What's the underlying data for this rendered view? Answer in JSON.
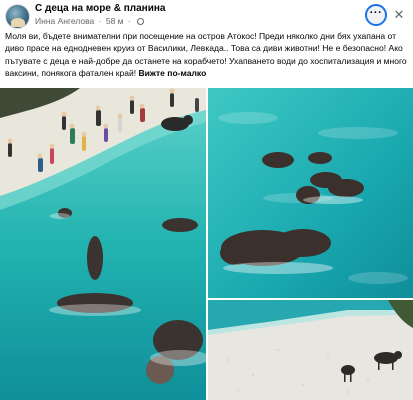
{
  "post": {
    "page_name": "С деца на море & планина",
    "author": "Инна Ангелова",
    "time": "58 м",
    "separator": "·",
    "more_icon_glyph": "···",
    "close_icon_glyph": "✕",
    "text": "Моля ви, бъдете внимателни при посещение на остров Атокос! Преди няколко дни бях ухапана от диво прасе на еднодневен круиз от Василики, Левкада.. Това са диви животни! Не е безопасно! Ако пътувате с деца е най-добре да останете на корабчето! Ухапването води до хоспитализация  и много ваксини, понякога  фатален край! ",
    "see_more": "Вижте по-малко"
  },
  "icons": [
    "page-avatar-icon",
    "globe-icon",
    "more-options-icon",
    "close-icon"
  ],
  "colors": {
    "text": "#050505",
    "muted": "#65676b",
    "focus_ring": "#1b74e4",
    "water": "#2fc0b8",
    "sand": "#e8e6e0"
  }
}
